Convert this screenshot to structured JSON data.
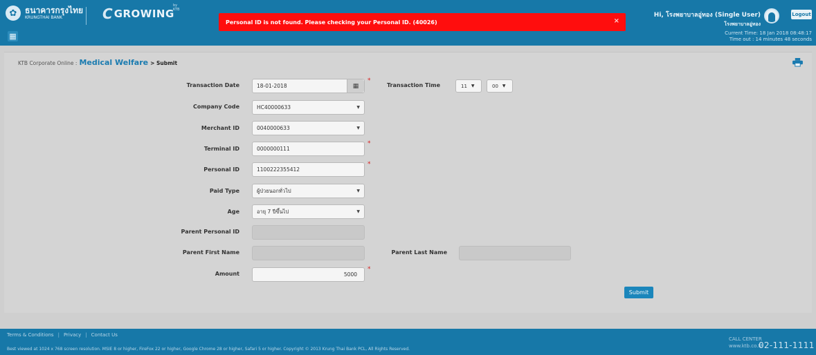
{
  "header": {
    "bank_thai": "ธนาคารกรุงไทย",
    "bank_en": "KRUNGTHAI BANK",
    "app_name": "GROWING",
    "app_by": "by KTB",
    "alert_text": "Personal ID is not found. Please checking your Personal ID. (40026)",
    "alert_close": "×",
    "user_greeting": "Hi, โรงพยาบาลอู่ทอง (Single User)",
    "user_sub": "โรงพยาบาลอู่ทอง",
    "logout_label": "Logout",
    "current_time": "Current Time: 18 Jan 2018 08:48:17",
    "time_out": "Time out : 14 minutes 48 seconds"
  },
  "breadcrumb": {
    "root": "KTB Corporate Online :",
    "section": "Medical Welfare",
    "current": "> Submit"
  },
  "form": {
    "transaction_date_label": "Transaction Date",
    "transaction_date_value": "18-01-2018",
    "transaction_time_label": "Transaction Time",
    "transaction_hour": "11",
    "transaction_minute": "00",
    "company_code_label": "Company Code",
    "company_code_value": "HC40000633",
    "merchant_id_label": "Merchant ID",
    "merchant_id_value": "0040000633",
    "terminal_id_label": "Terminal ID",
    "terminal_id_value": "0000000111",
    "personal_id_label": "Personal ID",
    "personal_id_value": "1100222355412",
    "paid_type_label": "Paid Type",
    "paid_type_value": "ผู้ป่วยนอกทั่วไป",
    "age_label": "Age",
    "age_value": "อายุ 7 ปีขึ้นไป",
    "parent_personal_id_label": "Parent Personal ID",
    "parent_personal_id_value": "",
    "parent_first_name_label": "Parent First Name",
    "parent_first_name_value": "",
    "parent_last_name_label": "Parent Last Name",
    "parent_last_name_value": "",
    "amount_label": "Amount",
    "amount_value": "5000",
    "required_mark": "*",
    "submit_label": "Submit"
  },
  "footer": {
    "links": [
      "Terms & Conditions",
      "Privacy",
      "Contact Us"
    ],
    "separator": "|",
    "copyright": "Best viewed at 1024 x 768 screen resolution. MSIE 8 or higher, FireFox 22 or higher, Google Chrome 28 or higher, Safari 5 or higher. Copyright © 2013 Krung Thai Bank PCL, All Rights Reserved.",
    "call_center_label": "CALL CENTER",
    "website": "www.ktb.co.th",
    "call_center_number": "02-111-1111"
  },
  "colors": {
    "header_blue": "#1778a8",
    "alert_red": "#ff0d0d",
    "title_blue": "#1a7bb0",
    "required_red": "#d71e1e"
  },
  "icons": [
    "ktb-emblem-icon",
    "growing-logo-icon",
    "apps-grid-icon",
    "close-icon",
    "avatar-icon",
    "calendar-icon",
    "chevron-down-icon",
    "print-icon"
  ]
}
